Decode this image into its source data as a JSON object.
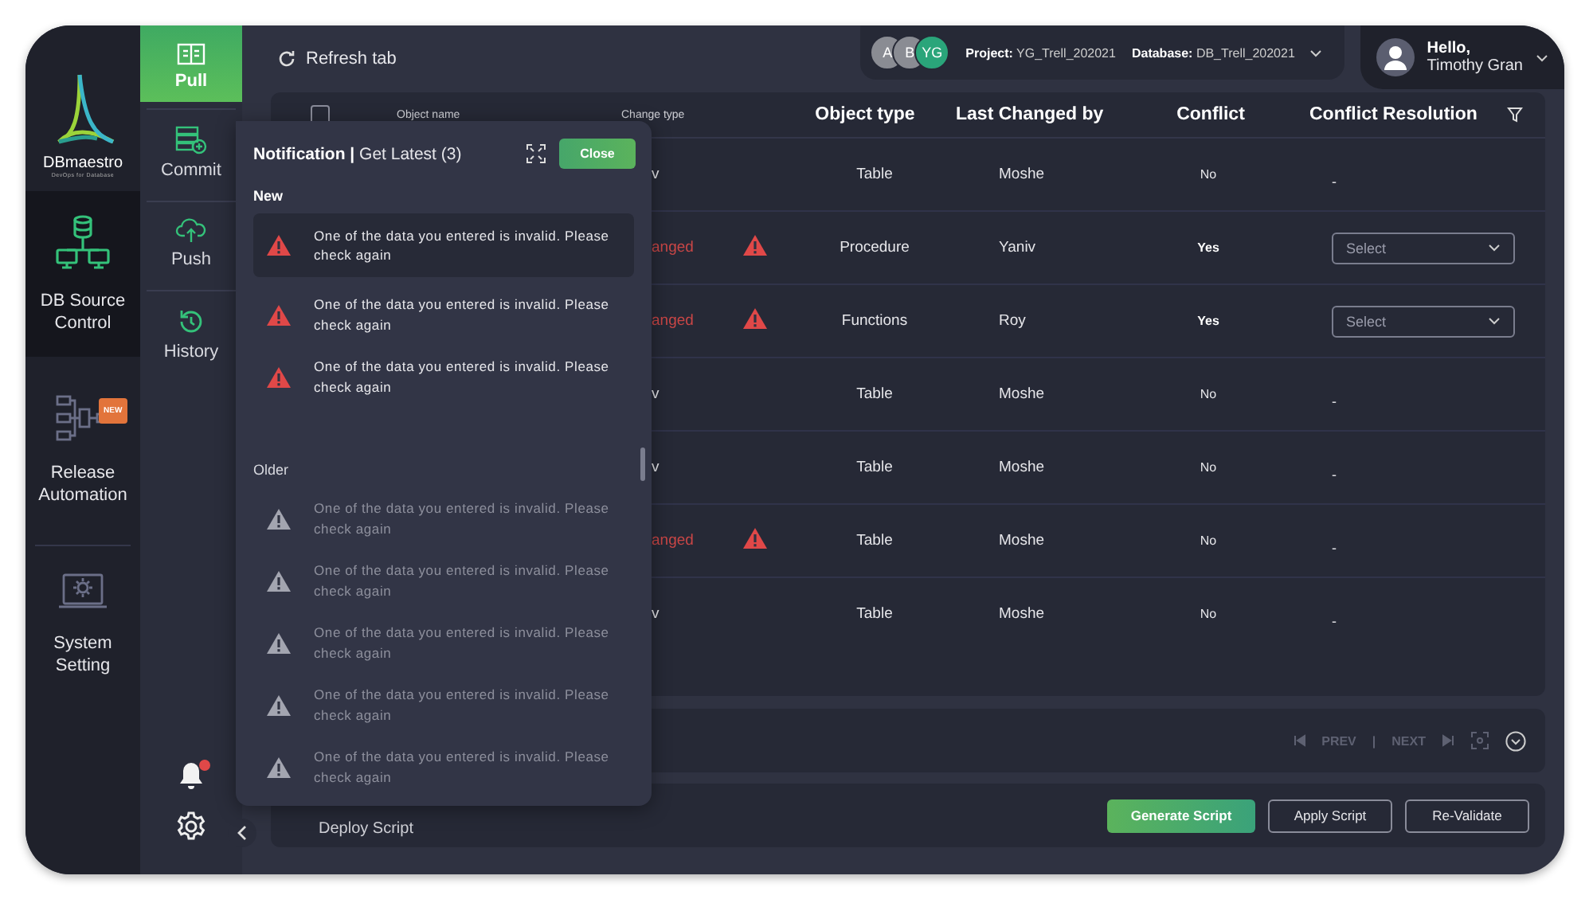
{
  "brand": {
    "name": "DBmaestro",
    "tagline": "DevOps for Database"
  },
  "sidebar": {
    "items": [
      {
        "label": "DB Source Control",
        "selected": true
      },
      {
        "label": "Release Automation",
        "selected": false,
        "badge": "NEW"
      },
      {
        "label": "System Setting",
        "selected": false
      }
    ]
  },
  "subnav": {
    "items": [
      {
        "label": "Pull",
        "selected": true
      },
      {
        "label": "Commit",
        "selected": false
      },
      {
        "label": "Push",
        "selected": false
      },
      {
        "label": "History",
        "selected": false
      }
    ],
    "bell_unread": true
  },
  "toolbar": {
    "refresh": "Refresh tab"
  },
  "context": {
    "avatars": [
      {
        "initials": "A",
        "color": "#8a8c93"
      },
      {
        "initials": "B",
        "color": "#8a8c93"
      },
      {
        "initials": "YG",
        "color": "#2aa57a"
      }
    ],
    "project_label": "Project:",
    "project": "YG_Trell_202021",
    "database_label": "Database:",
    "database": "DB_Trell_202021"
  },
  "user": {
    "greeting": "Hello,",
    "name": "Timothy Gran"
  },
  "table": {
    "select_all_checked": false,
    "columns": [
      "Object name",
      "Change type",
      "Object type",
      "Last Changed by",
      "Conflict",
      "Conflict Resolution"
    ],
    "rows": [
      {
        "change_type": "v",
        "changed": false,
        "object_type": "Table",
        "last_changed_by": "Moshe",
        "conflict": "No",
        "has_conflict": false,
        "resolution": {
          "kind": "text",
          "text": "-"
        }
      },
      {
        "change_type": "anged",
        "changed": true,
        "object_type": "Procedure",
        "last_changed_by": "Yaniv",
        "conflict": "Yes",
        "has_conflict": true,
        "resolution": {
          "kind": "select",
          "placeholder": "Select"
        }
      },
      {
        "change_type": "anged",
        "changed": true,
        "object_type": "Functions",
        "last_changed_by": "Roy",
        "conflict": "Yes",
        "has_conflict": true,
        "resolution": {
          "kind": "select",
          "placeholder": "Select"
        }
      },
      {
        "change_type": "v",
        "changed": false,
        "object_type": "Table",
        "last_changed_by": "Moshe",
        "conflict": "No",
        "has_conflict": false,
        "resolution": {
          "kind": "text",
          "text": "-"
        }
      },
      {
        "change_type": "v",
        "changed": false,
        "object_type": "Table",
        "last_changed_by": "Moshe",
        "conflict": "No",
        "has_conflict": false,
        "resolution": {
          "kind": "text",
          "text": "-"
        }
      },
      {
        "change_type": "anged",
        "changed": true,
        "object_type": "Table",
        "last_changed_by": "Moshe",
        "conflict": "No",
        "has_conflict": false,
        "resolution": {
          "kind": "text",
          "text": "-"
        }
      },
      {
        "change_type": "v",
        "changed": false,
        "object_type": "Table",
        "last_changed_by": "Moshe",
        "conflict": "No",
        "has_conflict": false,
        "resolution": {
          "kind": "text",
          "text": "-"
        }
      }
    ]
  },
  "pager": {
    "prev": "PREV",
    "separator": "|",
    "next": "NEXT"
  },
  "deploy": {
    "title": "Deploy Script",
    "buttons": [
      {
        "label": "Generate Script",
        "primary": true
      },
      {
        "label": "Apply Script",
        "primary": false
      },
      {
        "label": "Re-Validate",
        "primary": false
      }
    ]
  },
  "notifications": {
    "title": "**Notification |** Get Latest (3)",
    "close": "Close",
    "sections": [
      {
        "title": "New",
        "items": [
          {
            "text": "One of the data you entered is invalid. Please check again",
            "read": false,
            "selected": true
          },
          {
            "text": "One of the data you entered is invalid. Please check again",
            "read": false,
            "selected": false
          },
          {
            "text": "One of the data you entered is invalid. Please check again",
            "read": false,
            "selected": false
          }
        ]
      },
      {
        "title": "Older",
        "items": [
          {
            "text": "One of the data you entered is invalid. Please check again",
            "read": true,
            "selected": false
          },
          {
            "text": "One of the data you entered is invalid. Please check again",
            "read": true,
            "selected": false
          },
          {
            "text": "One of the data you entered is invalid. Please check again",
            "read": true,
            "selected": false
          },
          {
            "text": "One of the data you entered is invalid. Please check again",
            "read": true,
            "selected": false
          },
          {
            "text": "One of the data you entered is invalid. Please check again",
            "read": true,
            "selected": false
          }
        ]
      }
    ]
  }
}
